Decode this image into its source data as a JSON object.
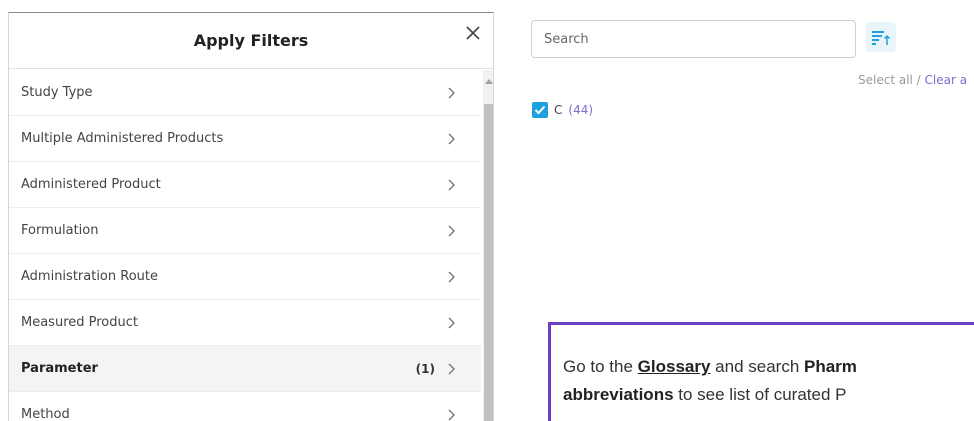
{
  "filters_panel": {
    "title": "Apply Filters",
    "items": [
      {
        "label": "Study Type",
        "count": "",
        "active": false
      },
      {
        "label": "Multiple Administered Products",
        "count": "",
        "active": false
      },
      {
        "label": "Administered Product",
        "count": "",
        "active": false
      },
      {
        "label": "Formulation",
        "count": "",
        "active": false
      },
      {
        "label": "Administration Route",
        "count": "",
        "active": false
      },
      {
        "label": "Measured Product",
        "count": "",
        "active": false
      },
      {
        "label": "Parameter",
        "count": "(1)",
        "active": true
      },
      {
        "label": "Method",
        "count": "",
        "active": false
      }
    ]
  },
  "search": {
    "placeholder": "Search"
  },
  "select_links": {
    "select_all": "Select all",
    "separator": " / ",
    "clear_all": "Clear a"
  },
  "options": [
    {
      "label": "C",
      "count": "(44)",
      "checked": true
    }
  ],
  "callout": {
    "line1_prefix": "Go to the ",
    "glossary": "Glossary",
    "line1_mid": " and search ",
    "line1_bold": "Pharm",
    "line2_bold": "abbreviations",
    "line2_rest": "  to  see list of curated P"
  },
  "colors": {
    "accent_purple": "#6a3fc2",
    "checkbox_blue": "#1fa1de",
    "link_purple": "#7b6fcf"
  },
  "icons": {
    "close": "close-icon",
    "chevron": "chevron-right-icon",
    "sort": "sort-icon",
    "check": "checkmark-icon"
  }
}
